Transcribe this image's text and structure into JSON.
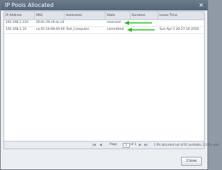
{
  "dialog": {
    "title": "IP Pools Allocated",
    "close_icon": "×"
  },
  "table": {
    "columns": [
      "IP Address",
      "MAC",
      "Hostname",
      "State",
      "Duration",
      "Lease Time"
    ],
    "rows": [
      [
        "192.168.1.110",
        "00:0c:29:c9:dc:c0",
        "",
        "reserved",
        "",
        ""
      ],
      [
        "192.168.1.10",
        "ca:01:14:68:00:00",
        "Test_Computer",
        "committed",
        "",
        "Sun Apr 5 20:27:16 2020"
      ]
    ]
  },
  "pager": {
    "first_icon": "|◀",
    "prev_icon": "◀",
    "page_label": "Page",
    "page_value": "1",
    "of_label": "of 1",
    "next_icon": "▶",
    "last_icon": "▶|",
    "summary": "2 IPs allocated out of 91 available, 2.20% used"
  },
  "buttons": {
    "close_label": "Close"
  },
  "colors": {
    "annotation_arrow": "#22c01a"
  }
}
